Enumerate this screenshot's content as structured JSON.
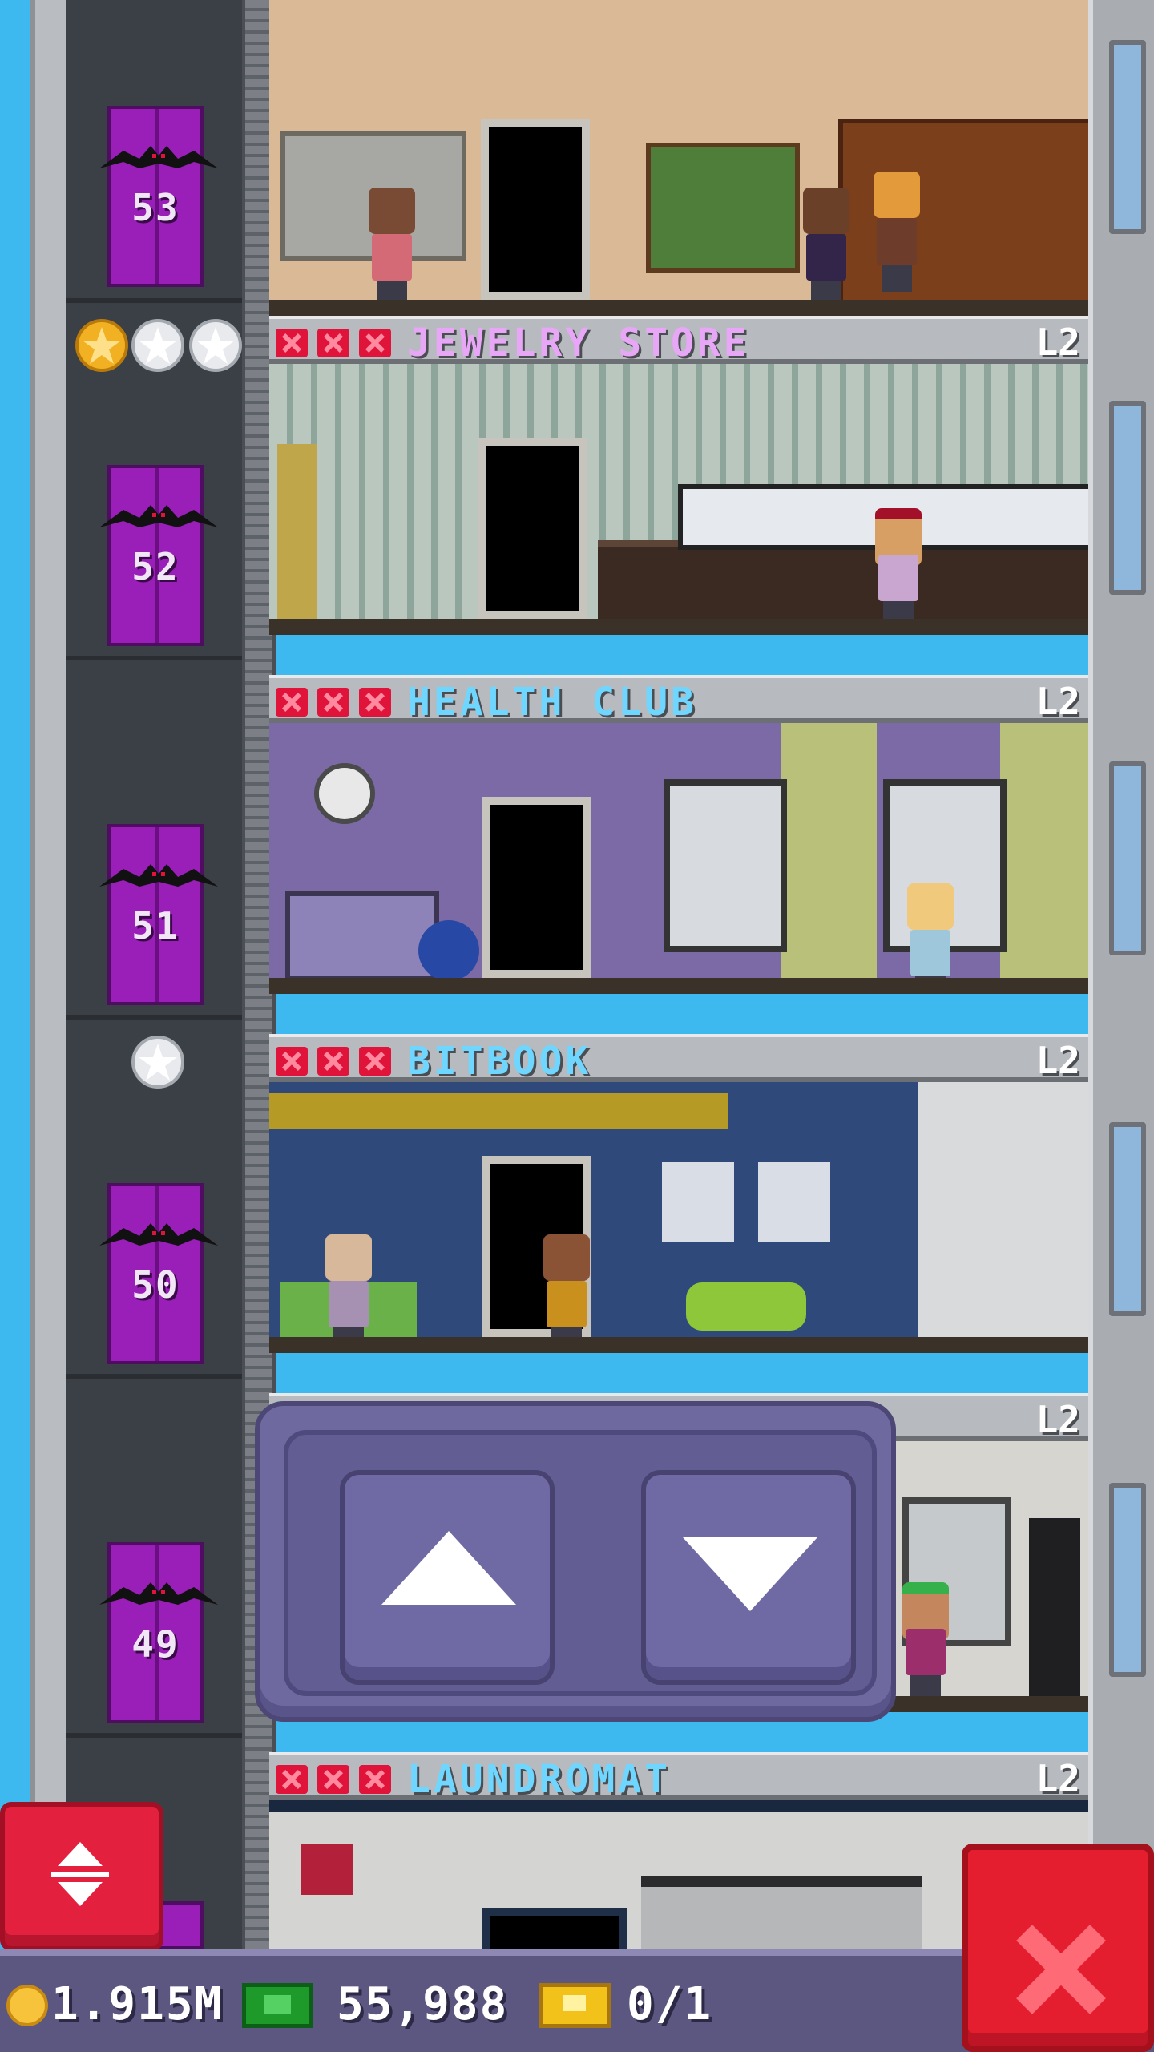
{
  "floors": [
    {
      "name": "",
      "level": "",
      "elevator_number": "53",
      "name_color": "#ffffff"
    },
    {
      "name": "JEWELRY STORE",
      "level": "L2",
      "elevator_number": "52",
      "name_color": "#e8a6f7"
    },
    {
      "name": "HEALTH CLUB",
      "level": "L2",
      "elevator_number": "51",
      "name_color": "#6fd7ff"
    },
    {
      "name": "BITBOOK",
      "level": "L2",
      "elevator_number": "50",
      "name_color": "#6fd7ff"
    },
    {
      "name": "",
      "level": "L2",
      "elevator_number": "49",
      "name_color": "#6fd7ff"
    },
    {
      "name": "LAUNDROMAT",
      "level": "L2",
      "elevator_number": "",
      "name_color": "#6fd7ff"
    }
  ],
  "status": {
    "coins": "1.915M",
    "bux": "55,988",
    "tickets": "0/1"
  },
  "icons": {
    "coin": "coin-icon",
    "bux": "bux-icon",
    "ticket": "ticket-icon",
    "star": "star-icon",
    "close": "close-icon",
    "arrow_up": "arrow-up-icon",
    "arrow_down": "arrow-down-icon"
  },
  "colors": {
    "sky": "#3db9ef",
    "elevator": "#9a1fb8",
    "x_mark": "#e0143a",
    "gold_star": "#f2b122",
    "silver_star": "#e8eaee",
    "nav_panel": "#6e699e",
    "close_button": "#e51e2f"
  }
}
